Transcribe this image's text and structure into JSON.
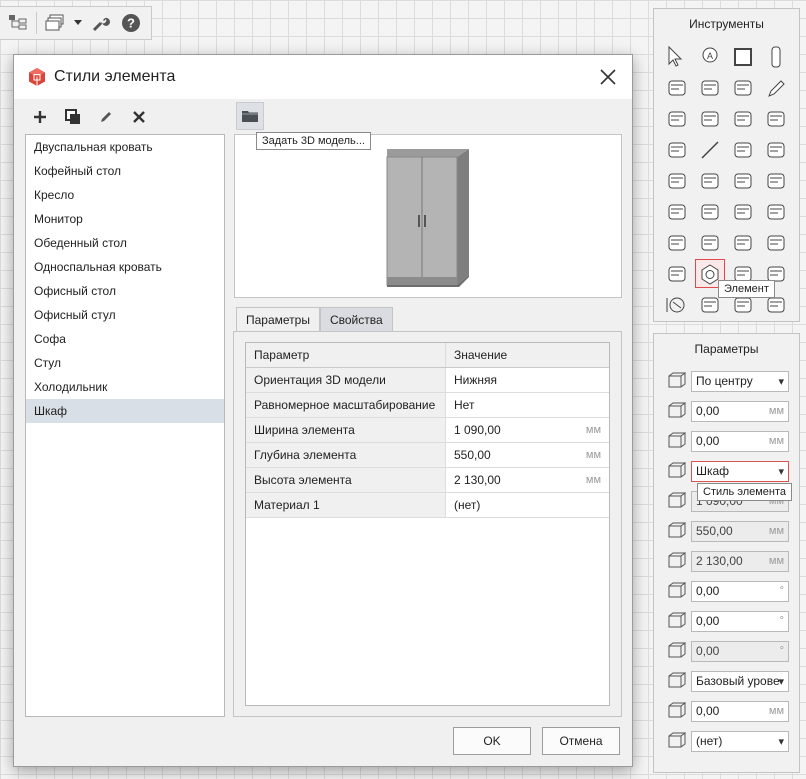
{
  "toolbar": {
    "icons": [
      "structure-icon",
      "layers-icon",
      "wrench-icon",
      "help-icon"
    ]
  },
  "tools_panel": {
    "title": "Инструменты",
    "tooltip": "Элемент",
    "tools": [
      "pointer",
      "text-objects",
      "box",
      "column",
      "slab",
      "beam",
      "roof",
      "pencil",
      "stair",
      "ramp",
      "door",
      "window",
      "table",
      "line",
      "chair",
      "bath",
      "toilet",
      "washer",
      "shower",
      "pipe",
      "drop-fixtures",
      "fan",
      "pipe-elbow",
      "furnace",
      "valves",
      "house-light",
      "electrical",
      "meter",
      "cabinet",
      "element",
      "camera-plus",
      "socket",
      "dimension",
      "curve",
      "rotate-grid",
      "wall-element"
    ]
  },
  "params_panel": {
    "title": "Параметры",
    "rows": [
      {
        "icon": "origin-icon",
        "value": "По центру",
        "type": "drop"
      },
      {
        "icon": "offset-x-icon",
        "value": "0,00",
        "unit": "мм"
      },
      {
        "icon": "offset-y-icon",
        "value": "0,00",
        "unit": "мм"
      },
      {
        "icon": "element-style-icon",
        "value": "Шкаф",
        "type": "drop"
      },
      {
        "icon": "width-icon",
        "value": "1 090,00",
        "unit": "мм",
        "disabled": true
      },
      {
        "icon": "depth-icon",
        "value": "550,00",
        "unit": "мм",
        "disabled": true
      },
      {
        "icon": "height-icon",
        "value": "2 130,00",
        "unit": "мм",
        "disabled": true
      },
      {
        "icon": "rotate-z-icon",
        "value": "0,00",
        "unit": "°"
      },
      {
        "icon": "rotate-x-icon",
        "value": "0,00",
        "unit": "°"
      },
      {
        "icon": "rotate-y-icon",
        "value": "0,00",
        "unit": "°",
        "disabled": true
      },
      {
        "icon": "level-icon",
        "value": "Базовый урове",
        "type": "drop"
      },
      {
        "icon": "elevation-icon",
        "value": "0,00",
        "unit": "мм"
      },
      {
        "icon": "label-icon",
        "value": "(нет)",
        "type": "drop"
      }
    ],
    "tooltip": "Стиль элемента"
  },
  "dialog": {
    "title": "Стили элемента",
    "toolbar": [
      "add-icon",
      "copy-icon",
      "edit-icon",
      "delete-icon"
    ],
    "list": [
      "Двуспальная кровать",
      "Кофейный стол",
      "Кресло",
      "Монитор",
      "Обеденный стол",
      "Односпальная кровать",
      "Офисный стол",
      "Офисный стул",
      "Софа",
      "Стул",
      "Холодильник",
      "Шкаф"
    ],
    "selected_item": "Шкаф",
    "tooltip_3d": "Задать 3D модель...",
    "tabs": [
      "Параметры",
      "Свойства"
    ],
    "active_tab": "Параметры",
    "table": {
      "header": [
        "Параметр",
        "Значение"
      ],
      "rows": [
        {
          "name": "Ориентация 3D модели",
          "value": "Нижняя",
          "unit": ""
        },
        {
          "name": "Равномерное масштабирование",
          "value": "Нет",
          "unit": ""
        },
        {
          "name": "Ширина элемента",
          "value": "1 090,00",
          "unit": "мм"
        },
        {
          "name": "Глубина  элемента",
          "value": "550,00",
          "unit": "мм"
        },
        {
          "name": "Высота элемента",
          "value": "2 130,00",
          "unit": "мм"
        },
        {
          "name": "Материал 1",
          "value": "(нет)",
          "unit": ""
        }
      ]
    },
    "ok": "OK",
    "cancel": "Отмена"
  }
}
